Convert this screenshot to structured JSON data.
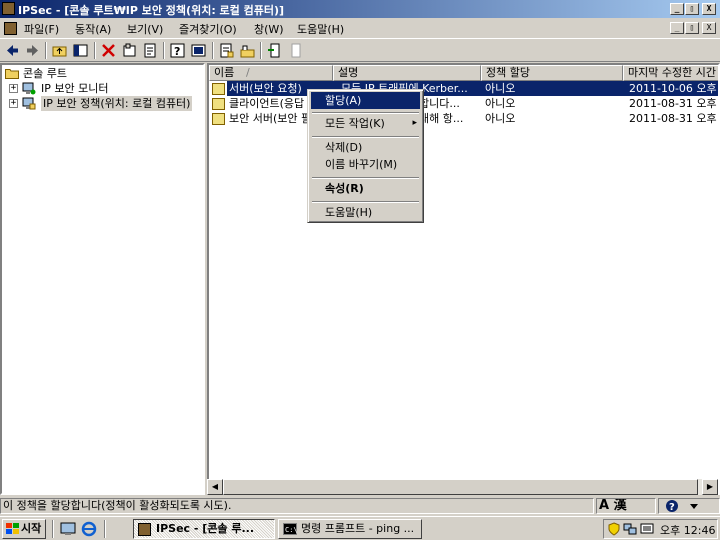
{
  "window": {
    "title": "IPSec - [콘솔 루트₩IP 보안 정책(위치: 로컬 컴퓨터)]",
    "min": "_",
    "max": "▯",
    "close": "X"
  },
  "menubar": {
    "items": [
      "파일(F)",
      "동작(A)",
      "보기(V)",
      "즐겨찾기(O)",
      "창(W)",
      "도움말(H)"
    ]
  },
  "tree": {
    "root": "콘솔 루트",
    "items": [
      {
        "label": "IP 보안 모니터",
        "expander": "+"
      },
      {
        "label": "IP 보안 정책(위치: 로컬 컴퓨터)",
        "expander": "+"
      }
    ]
  },
  "list": {
    "columns": [
      "이름",
      "설명",
      "정책 할당",
      "마지막 수정한 시간"
    ],
    "sort_indicator": "/",
    "rows": [
      {
        "name": "서버(보안 요청)",
        "desc": "모든 IP 트래픽에 Kerber...",
        "assigned": "아니오",
        "modified": "2011-10-06 오후 12"
      },
      {
        "name": "클라이언트(응답",
        "desc": "합니다...",
        "assigned": "아니오",
        "modified": "2011-08-31 오후 3"
      },
      {
        "name": "보안 서버(보안 필",
        "desc": "대해 항...",
        "assigned": "아니오",
        "modified": "2011-08-31 오후 3"
      }
    ]
  },
  "context_menu": {
    "items": [
      "할당(A)",
      "모든 작업(K)",
      "삭제(D)",
      "이름 바꾸기(M)",
      "속성(R)",
      "도움말(H)"
    ],
    "submenu_arrow": "▸"
  },
  "statusbar": {
    "message": "이 정책을 할당합니다(정책이 활성화되도록 시도)."
  },
  "taskbar": {
    "start": "시작",
    "tasks": [
      "IPSec - [콘솔 루...",
      "명령 프롬프트 - ping ..."
    ],
    "tray_ime": "A 漢",
    "clock": "오후 12:46"
  }
}
